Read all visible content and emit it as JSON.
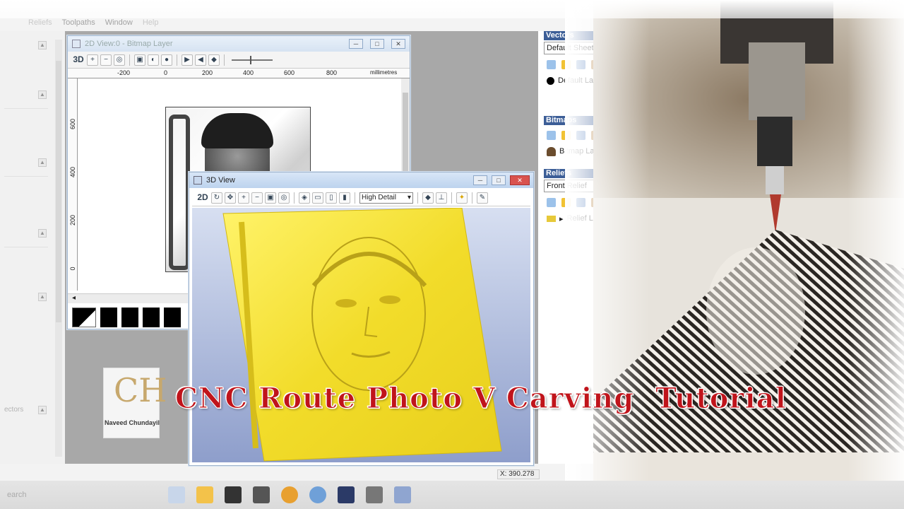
{
  "menu": {
    "items": [
      "Reliefs",
      "Toolpaths",
      "Window",
      "Help"
    ]
  },
  "left_panel": {
    "label": "ectors"
  },
  "view2d": {
    "title": "2D View:0 - Bitmap Layer",
    "mode": "3D",
    "ruler_units": "millimetres",
    "ruler_top": [
      "-200",
      "0",
      "200",
      "400",
      "600",
      "800"
    ],
    "ruler_left": [
      "600",
      "400",
      "200",
      "0"
    ]
  },
  "view3d": {
    "title": "3D View",
    "mode": "2D",
    "detail": "High Detail"
  },
  "vectors": {
    "header": "Vectors",
    "sheet": "Default Sheet",
    "layer": "Default Layer"
  },
  "bitmaps": {
    "header": "Bitmaps",
    "layer": "Bitmap Layer"
  },
  "reliefs": {
    "header": "Reliefs",
    "combo": "Front Relief",
    "layer": "Relief Layer"
  },
  "statusbar": {
    "coord": "X: 390.278"
  },
  "taskbar": {
    "search": "earch"
  },
  "logo": {
    "initials": "CH",
    "name": "Naveed Chundayil"
  },
  "headline": "CNC Route Photo V Carving  Tutorial"
}
